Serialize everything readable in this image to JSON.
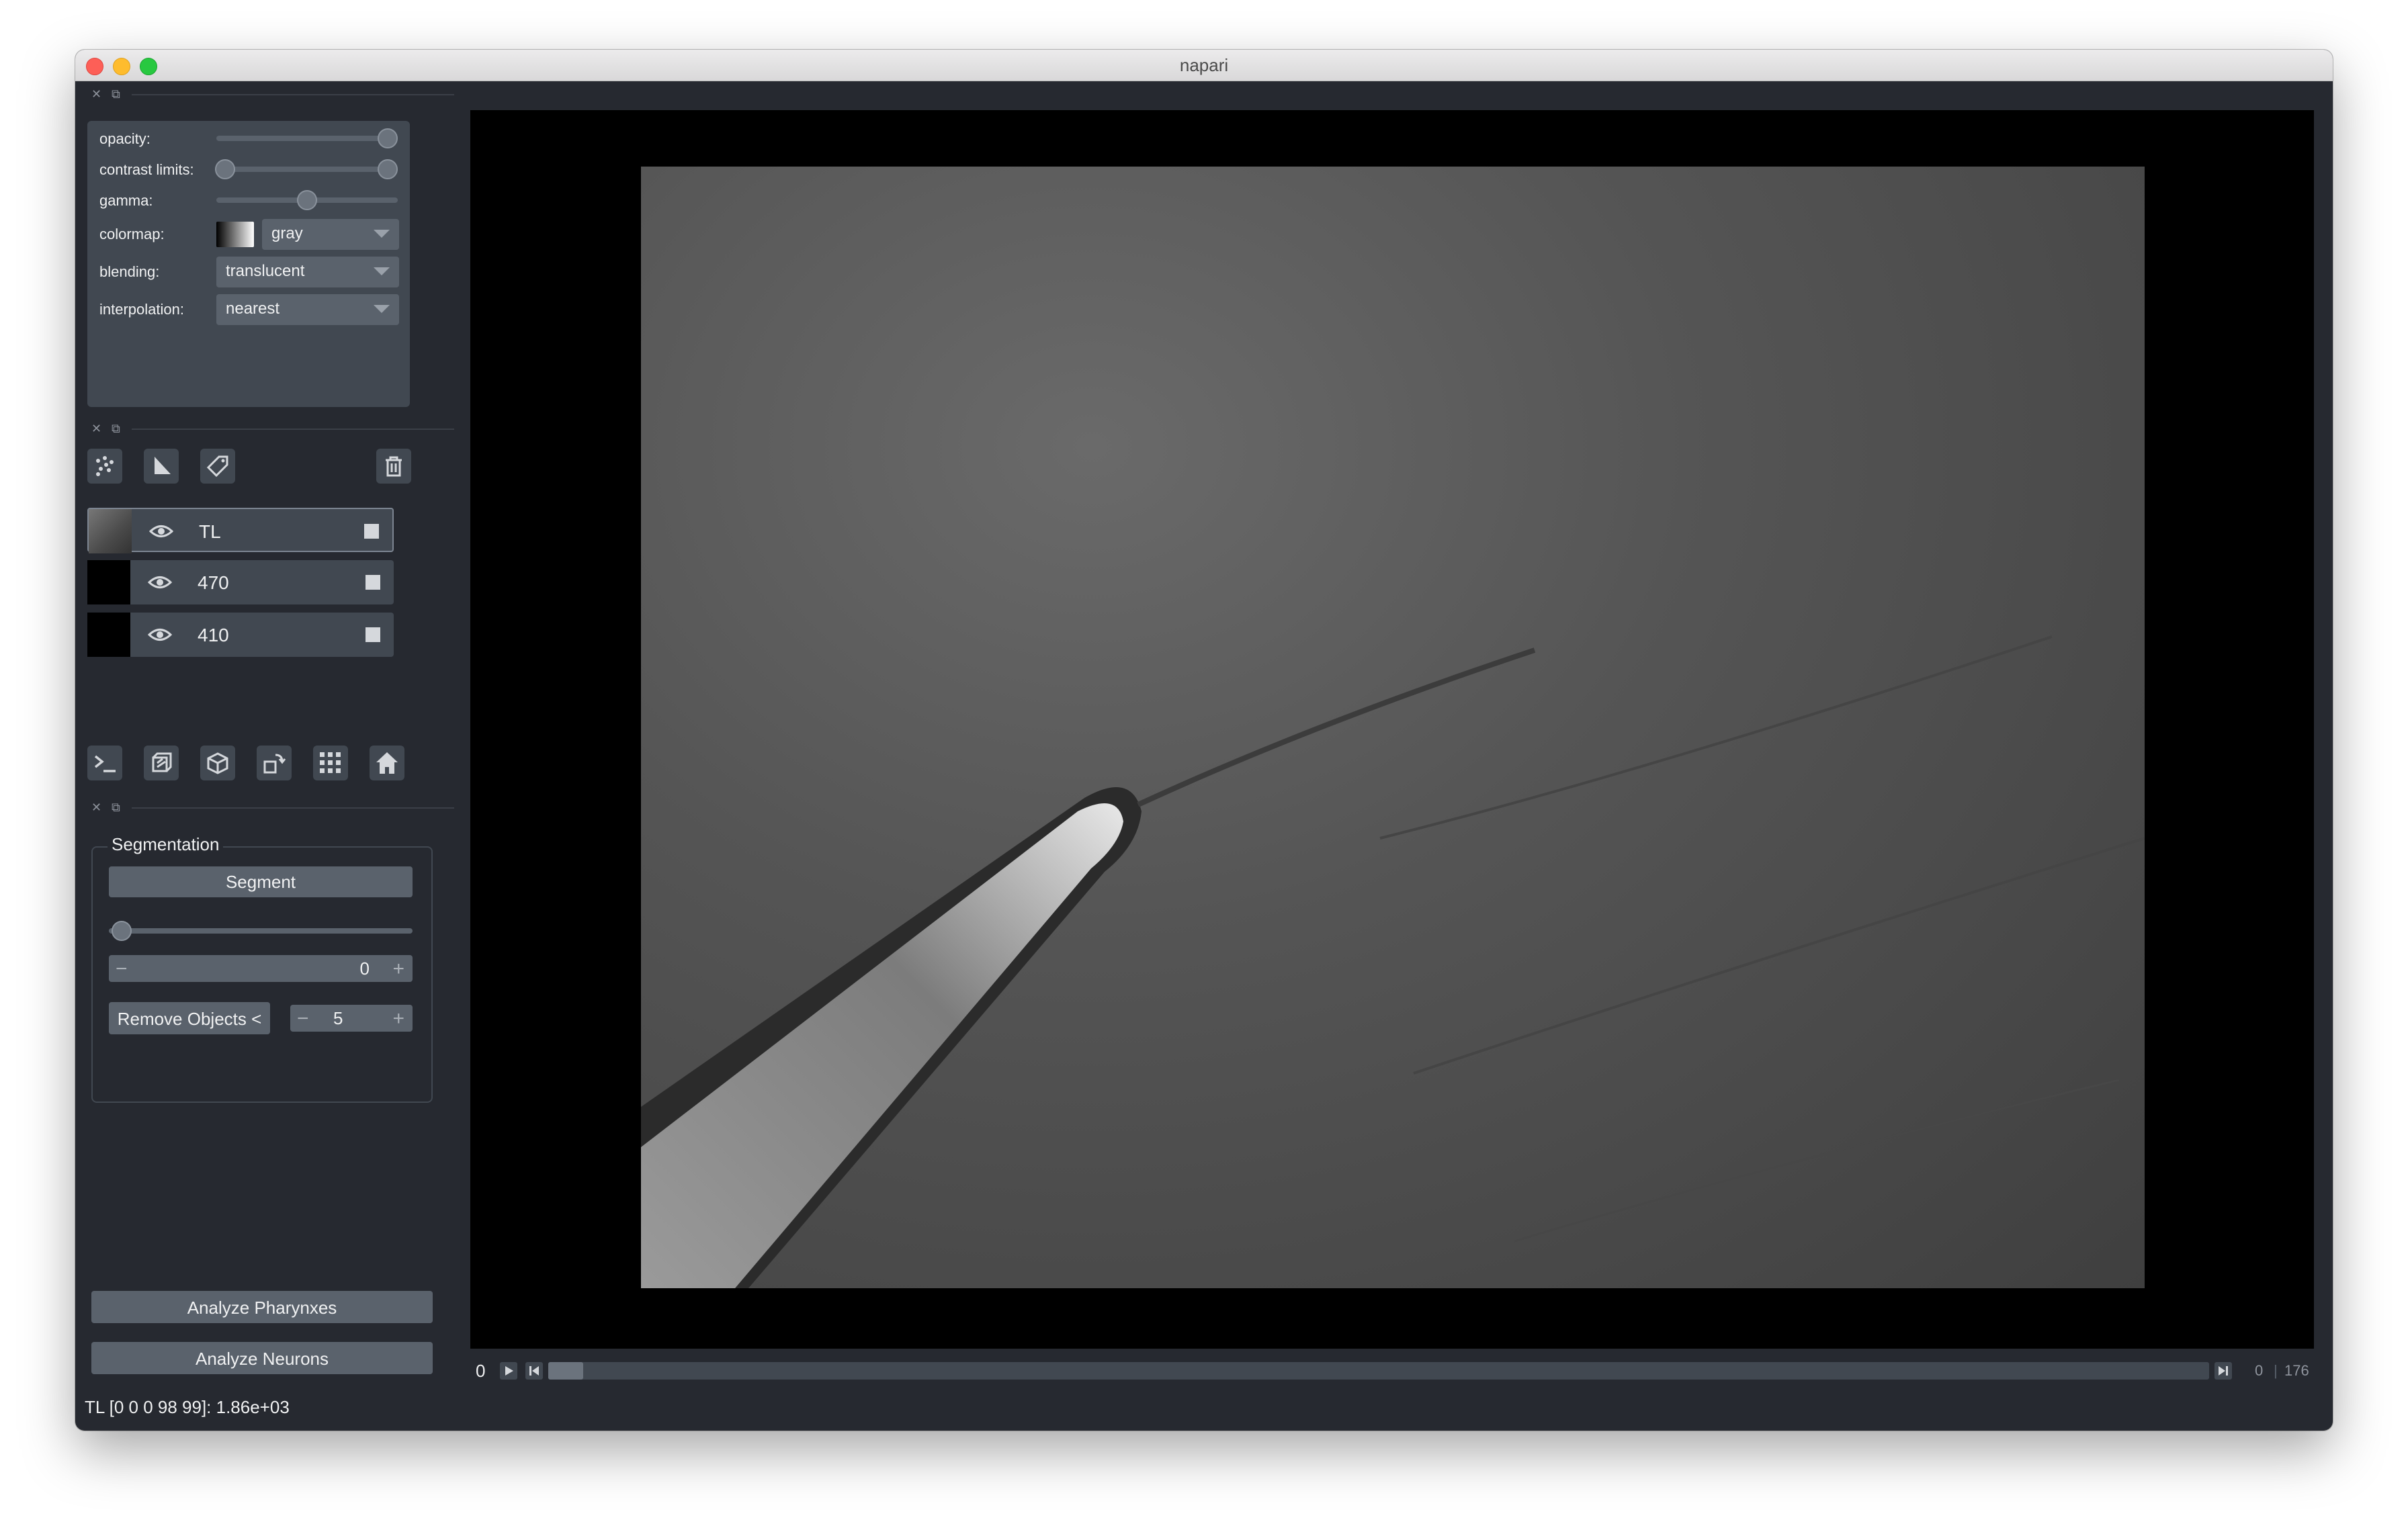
{
  "window": {
    "title": "napari"
  },
  "layer_controls": {
    "opacity_label": "opacity:",
    "contrast_label": "contrast limits:",
    "gamma_label": "gamma:",
    "colormap_label": "colormap:",
    "colormap_value": "gray",
    "blending_label": "blending:",
    "blending_value": "translucent",
    "interpolation_label": "interpolation:",
    "interpolation_value": "nearest",
    "opacity_value": 1.0,
    "gamma_value": 0.5
  },
  "layers": [
    {
      "name": "TL",
      "visible": true,
      "selected": true
    },
    {
      "name": "470",
      "visible": true,
      "selected": false
    },
    {
      "name": "410",
      "visible": true,
      "selected": false
    }
  ],
  "segmentation": {
    "group_title": "Segmentation",
    "segment_button": "Segment",
    "threshold_value": "0",
    "remove_objects_button": "Remove Objects <",
    "remove_objects_value": "5"
  },
  "analysis": {
    "pharynx_button": "Analyze Pharynxes",
    "neurons_button": "Analyze Neurons"
  },
  "dims_slider": {
    "left_label": "0",
    "current": "0",
    "max": "176"
  },
  "status_bar": {
    "text": "TL [0  0  0 98 99]: 1.86e+03"
  },
  "colors": {
    "background": "#262930",
    "panel": "#414851",
    "control": "#5a626c",
    "text": "#f0f1f2"
  }
}
